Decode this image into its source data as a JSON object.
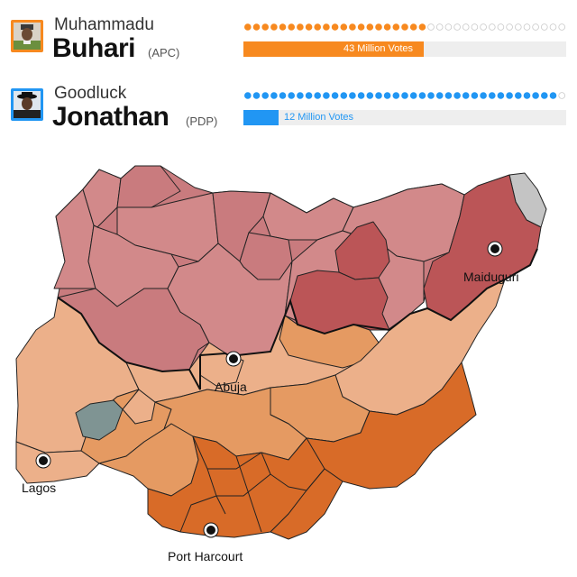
{
  "candidates": [
    {
      "first_name": "Muhammadu",
      "last_name": "Buhari",
      "party": "(APC)",
      "votes_label": "43 Million Votes",
      "color": "#f7891f",
      "vote_fraction": 0.56,
      "dots_total": 37,
      "dots_filled": 21,
      "avatar_icon": "candidate-portrait-icon"
    },
    {
      "first_name": "Goodluck",
      "last_name": "Jonathan",
      "party": "(PDP)",
      "votes_label": "12 Million Votes",
      "color": "#2196f3",
      "vote_fraction": 0.11,
      "dots_total": 37,
      "dots_filled": 36,
      "avatar_icon": "candidate-portrait-icon"
    }
  ],
  "map": {
    "cities": {
      "abuja": "Abuja",
      "lagos": "Lagos",
      "maiduguri": "Maiduguri",
      "port_harcourt": "Port Harcourt"
    },
    "colors": {
      "apc_light": "#d2898a",
      "apc_medium": "#c97b7e",
      "apc_strong": "#bb5557",
      "pdp_light": "#ecb08a",
      "pdp_medium": "#e59a62",
      "pdp_strong": "#d86b28",
      "no_result": "#7f9493",
      "unavailable": "#c4c4c4"
    }
  }
}
